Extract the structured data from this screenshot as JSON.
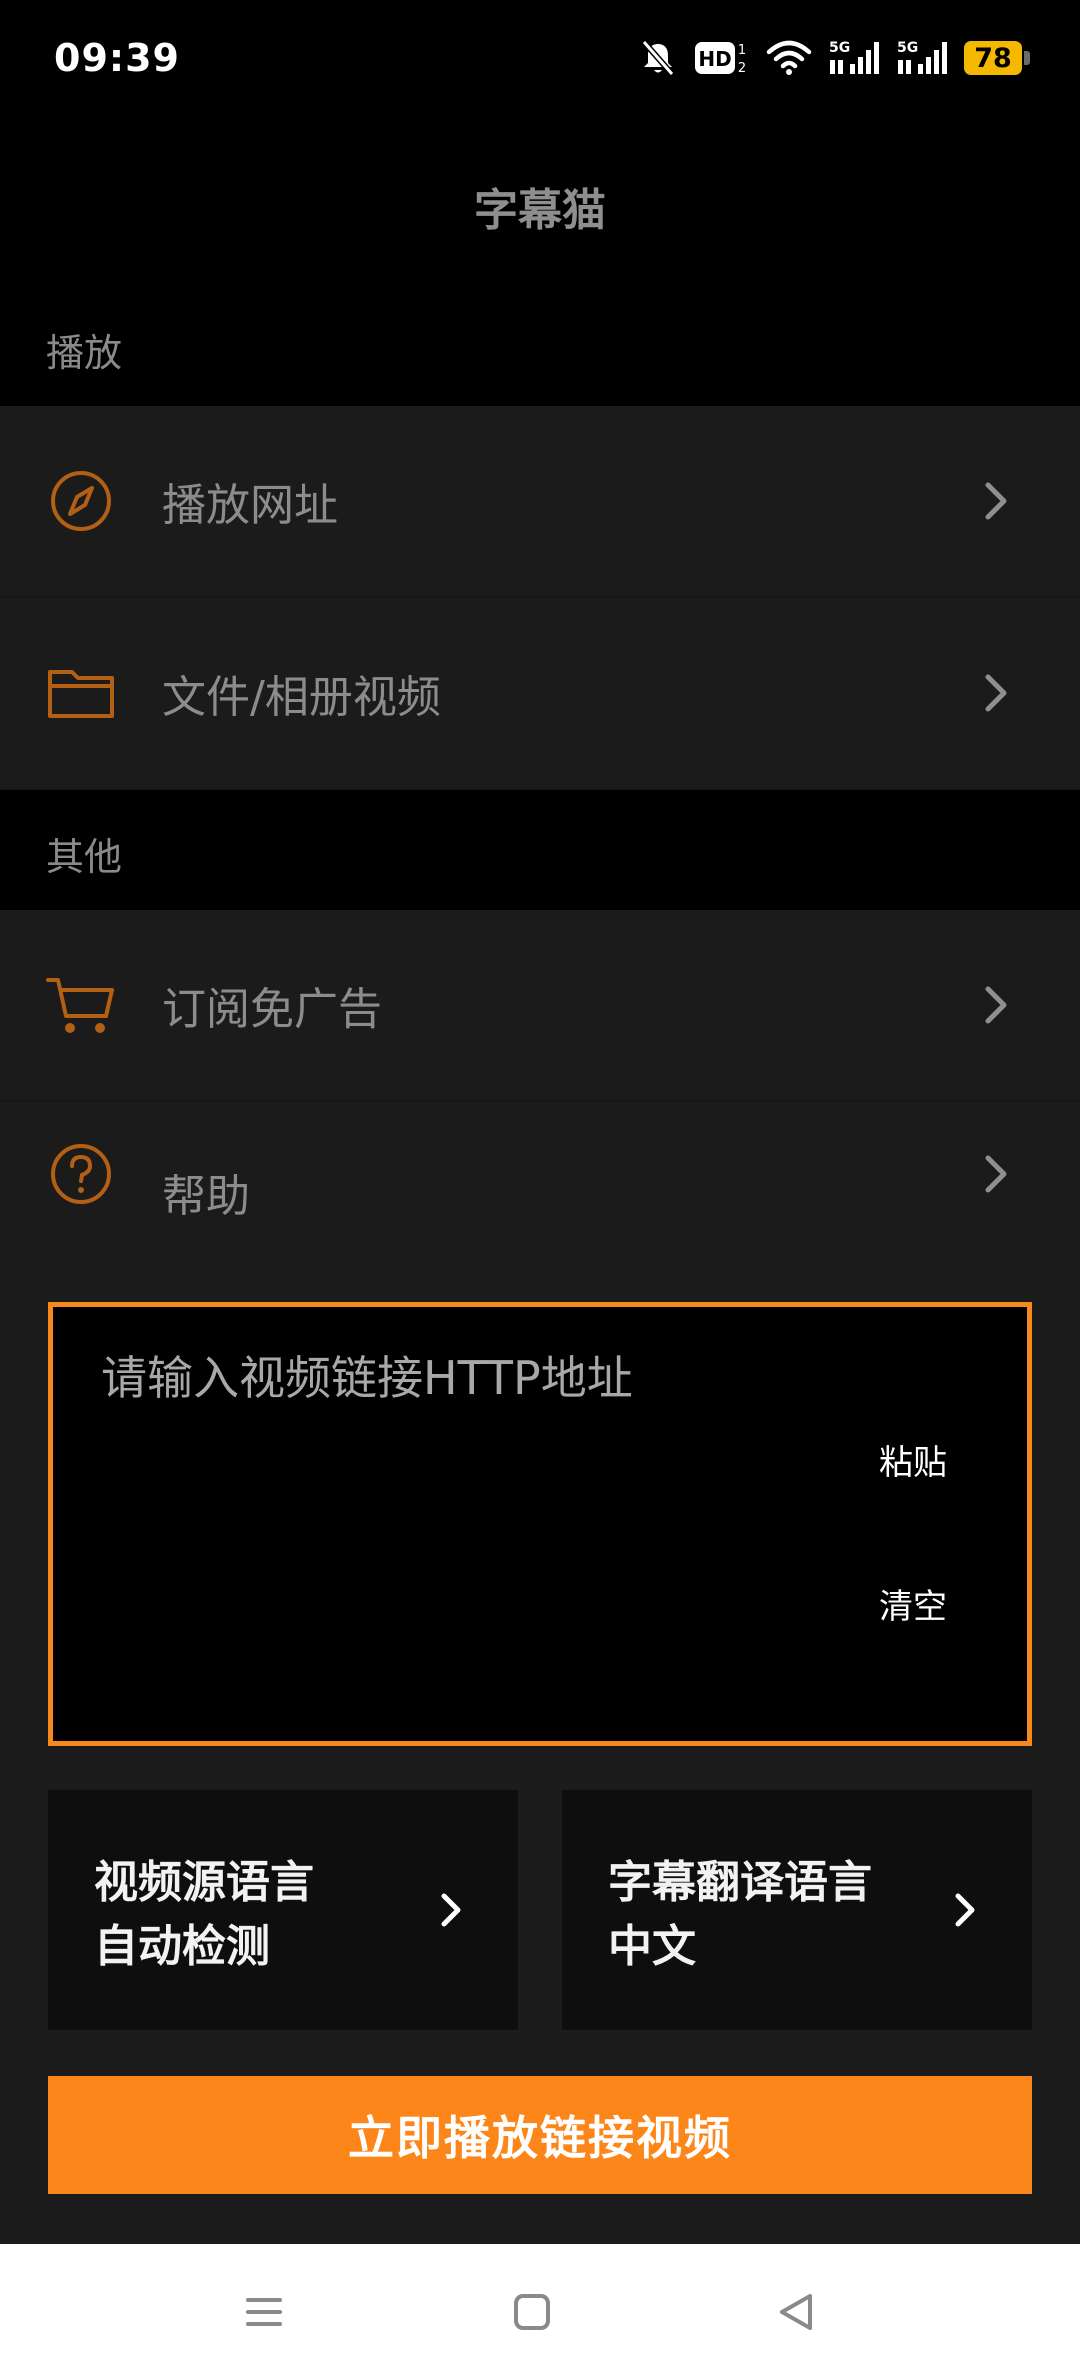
{
  "status_bar": {
    "time": "09:39",
    "battery": "78",
    "icons": [
      "mute-bell-icon",
      "hd-icon",
      "wifi-icon",
      "signal-5g-icon",
      "signal-5g-icon",
      "battery-icon"
    ],
    "hd_label": "HD",
    "net_label_1": "5G",
    "net_label_2": "5G"
  },
  "header": {
    "title": "字幕猫"
  },
  "sections": {
    "play": "播放",
    "other": "其他"
  },
  "menu": {
    "play_url": {
      "label": "播放网址",
      "icon": "compass-icon"
    },
    "file_video": {
      "label": "文件/相册视频",
      "icon": "folder-icon"
    },
    "subscribe": {
      "label": "订阅免广告",
      "icon": "cart-icon"
    },
    "help": {
      "label": "帮助",
      "icon": "help-circle-icon"
    }
  },
  "url_box": {
    "placeholder": "请输入视频链接HTTP地址",
    "value": "",
    "paste_label": "粘贴",
    "clear_label": "清空"
  },
  "language": {
    "source_title": "视频源语言",
    "source_value": "自动检测",
    "target_title": "字幕翻译语言",
    "target_value": "中文"
  },
  "actions": {
    "play_now": "立即播放链接视频"
  },
  "colors": {
    "accent": "#fd861a",
    "icon_orange": "#b35f14",
    "background": "#000000",
    "row_background": "#1b1b1b"
  }
}
